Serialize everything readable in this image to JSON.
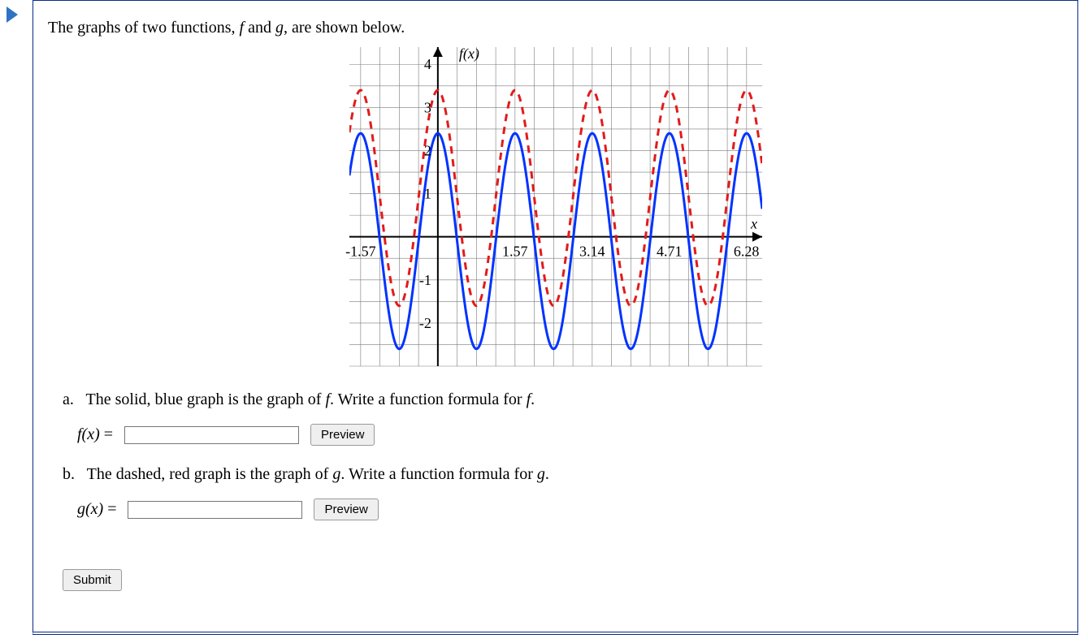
{
  "intro": "The graphs of two functions, f and g, are shown below.",
  "intro_parts": {
    "p1": "The graphs of two functions, ",
    "f": "f",
    "and": " and ",
    "g": "g",
    "p2": ", are shown below."
  },
  "questions": {
    "a": {
      "bullet": "a.",
      "text_parts": {
        "p1": "The solid, blue graph is the graph of ",
        "f1": "f",
        "p2": ". Write a function formula for ",
        "f2": "f",
        "p3": "."
      },
      "lhs": "f(x) = ",
      "lhs_math": "f(x)",
      "eq": " = ",
      "preview": "Preview"
    },
    "b": {
      "bullet": "b.",
      "text_parts": {
        "p1": "The dashed, red graph is the graph of ",
        "g1": "g",
        "p2": ". Write a function formula for ",
        "g2": "g",
        "p3": "."
      },
      "lhs_math": "g(x)",
      "eq": " = ",
      "preview": "Preview"
    }
  },
  "submit": "Submit",
  "chart_data": {
    "type": "line",
    "title": "",
    "xlabel": "x",
    "ylabel": "f(x)",
    "xlim": [
      -1.8,
      6.6
    ],
    "ylim": [
      -3.0,
      4.4
    ],
    "xticks": [
      -1.57,
      1.57,
      3.14,
      4.71,
      6.28
    ],
    "yticks": [
      -2,
      -1,
      1,
      2,
      3,
      4
    ],
    "grid": true,
    "series": [
      {
        "name": "f",
        "style": "solid",
        "color": "#0033ff",
        "formula": "2.5*cos(4*x) - 0.1",
        "amplitude": 2.5,
        "angular_frequency": 4,
        "vertical_shift": -0.1,
        "phase_shift": 0
      },
      {
        "name": "g",
        "style": "dashed",
        "color": "#e21b1b",
        "formula": "2.5*cos(4*x) + 0.9",
        "amplitude": 2.5,
        "angular_frequency": 4,
        "vertical_shift": 0.9,
        "phase_shift": 0
      }
    ],
    "axis_labels": {
      "y_top": "f(x)",
      "x_right": "x",
      "y4": "4",
      "y3": "3",
      "y2": "2",
      "y1": "1",
      "yn1": "-1",
      "yn2": "-2",
      "xn157": "-1.57",
      "x157": "1.57",
      "x314": "3.14",
      "x471": "4.71",
      "x628": "6.28"
    }
  }
}
